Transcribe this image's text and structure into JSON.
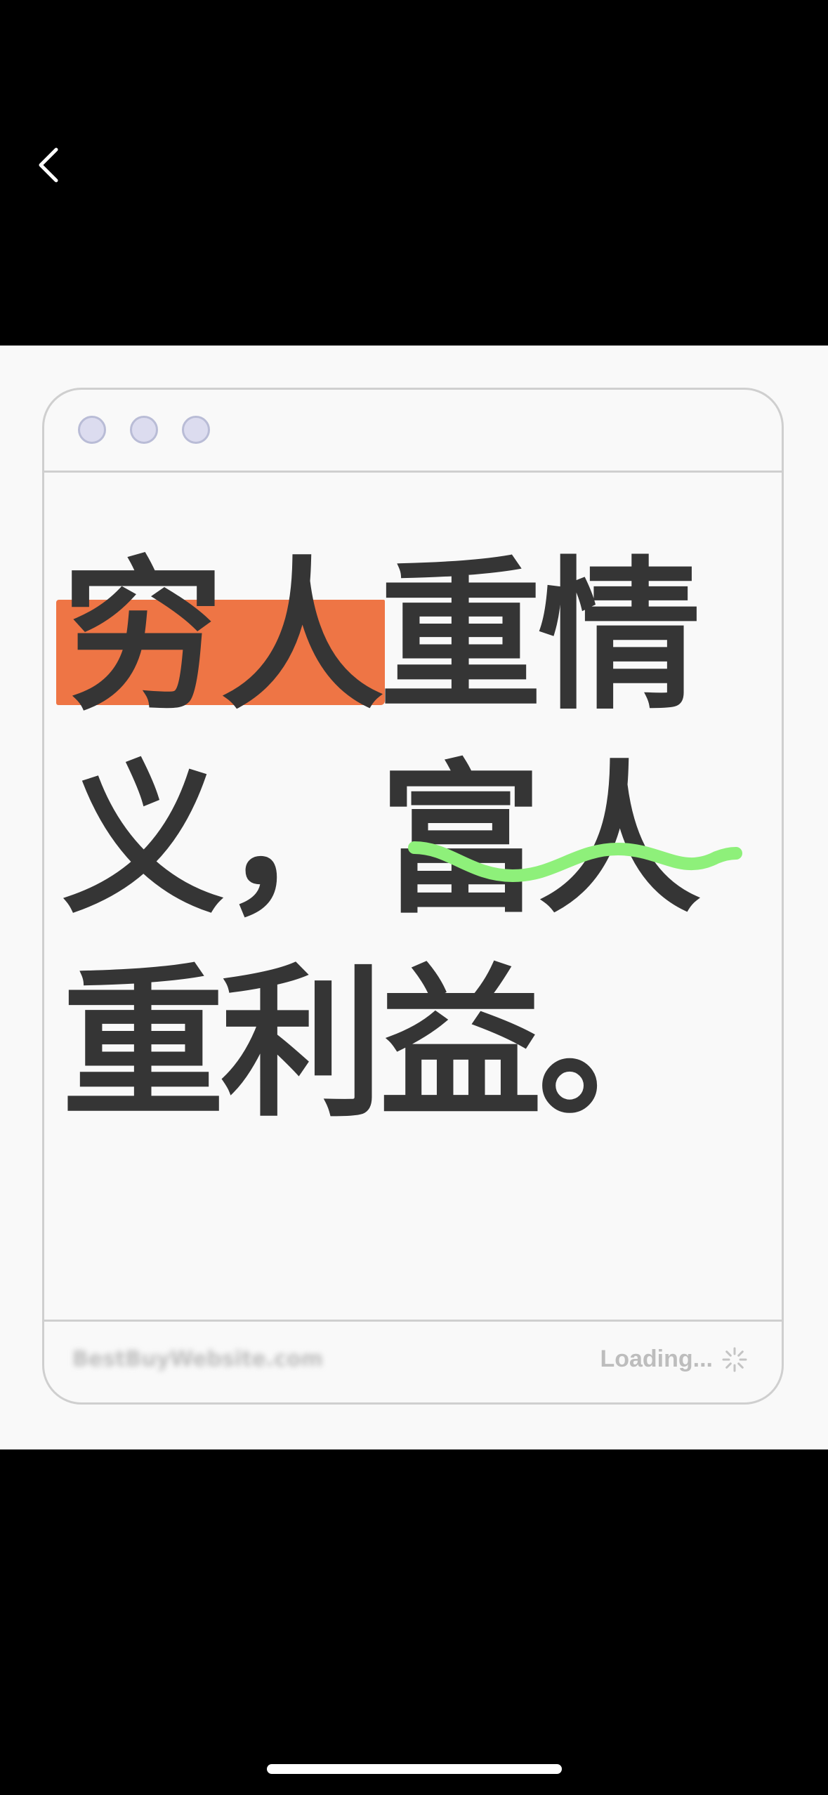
{
  "quote": {
    "line1": {
      "highlighted": "穷人",
      "rest": "重情"
    },
    "line2": {
      "plain": "义，",
      "underlined": "富人"
    },
    "line3": {
      "text": "重利益。"
    }
  },
  "footer": {
    "site": "BestBuyWebsite.com",
    "status": "Loading..."
  },
  "colors": {
    "highlight": "#ee7545",
    "underline_wave": "#8ef07a",
    "text": "#353535",
    "panel_background": "#f9f9f9",
    "window_dots": "#dcdcef"
  },
  "icons": {
    "back": "chevron-left-icon",
    "spinner": "spinner-icon"
  }
}
